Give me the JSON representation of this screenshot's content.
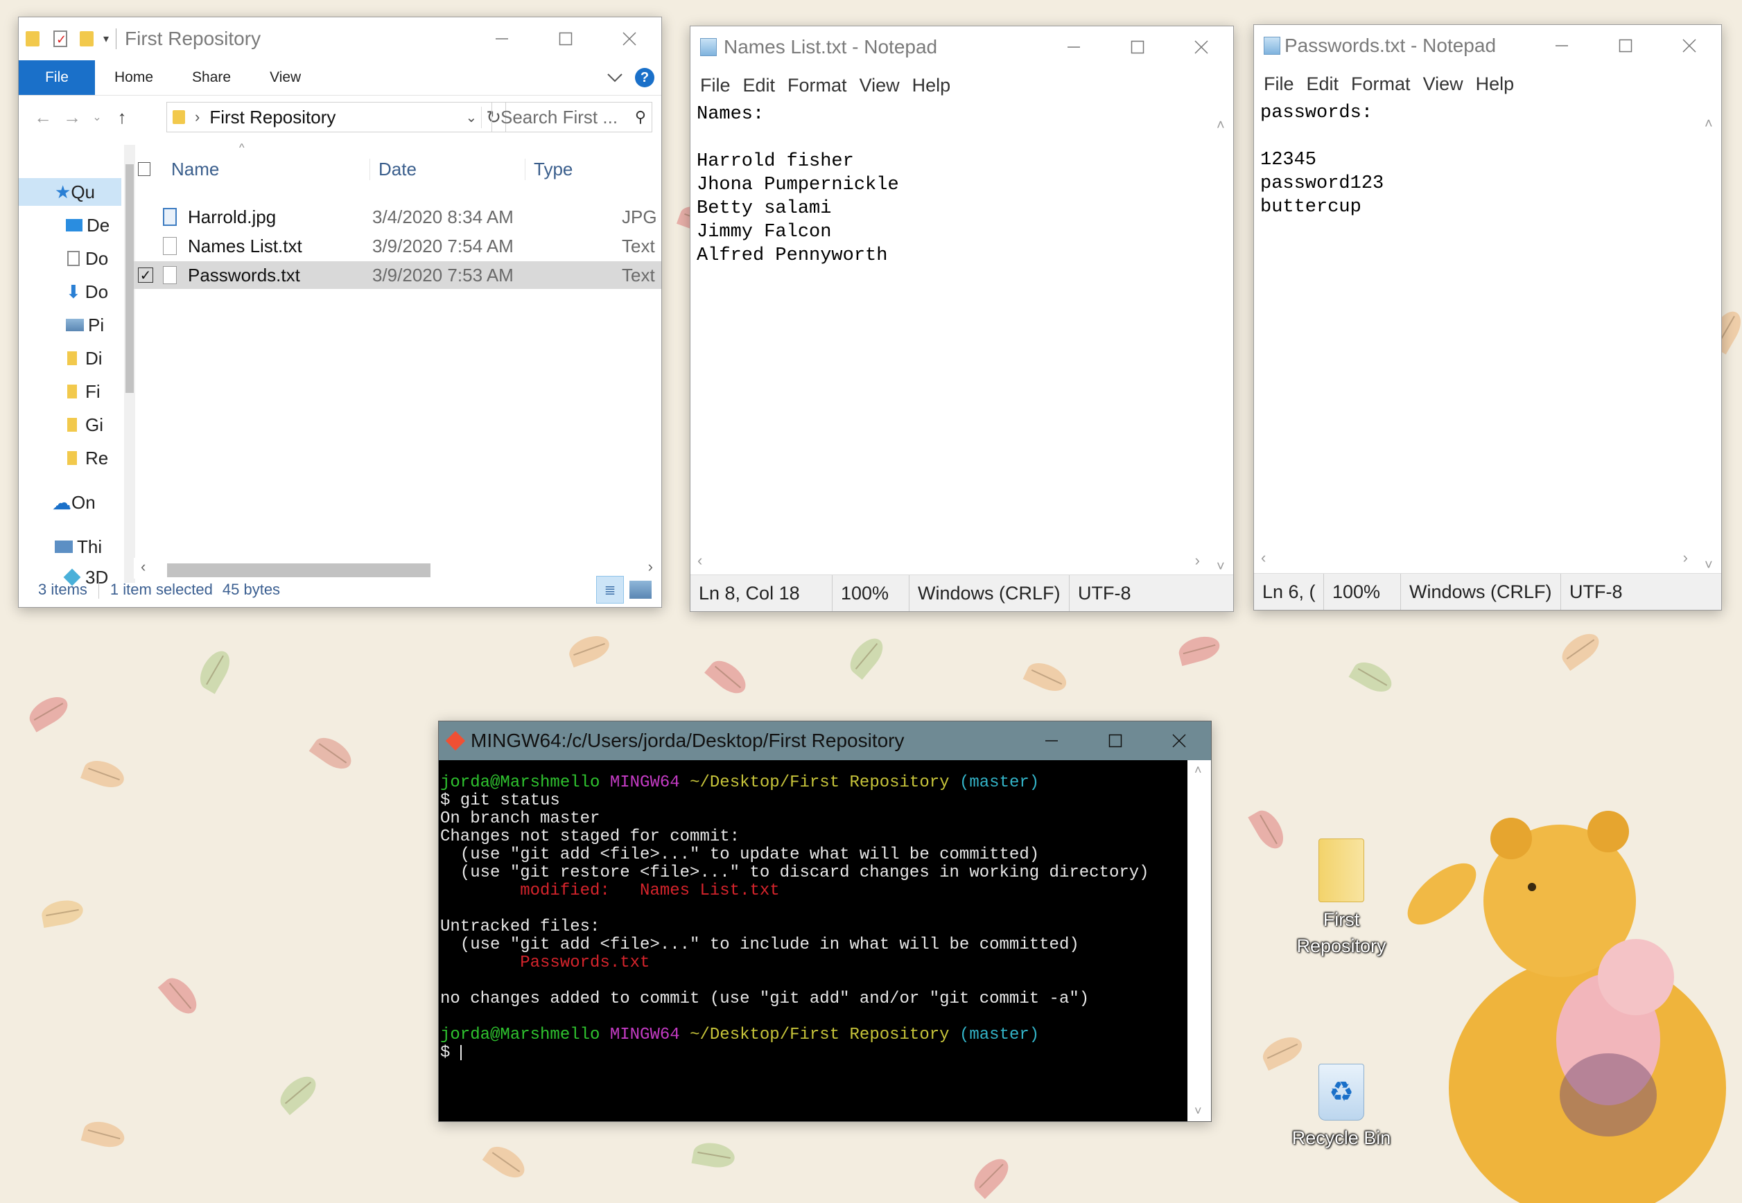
{
  "explorer": {
    "title": "First Repository",
    "ribbon_tabs": [
      "File",
      "Home",
      "Share",
      "View"
    ],
    "address": "First Repository",
    "search_placeholder": "Search First ...",
    "columns": [
      "Name",
      "Date",
      "Type"
    ],
    "nav_items": [
      "Qu",
      "De",
      "Do",
      "Do",
      "Pi",
      "Di",
      "Fi",
      "Gi",
      "Re",
      "On",
      "Thi",
      "3D"
    ],
    "files": [
      {
        "name": "Harrold.jpg",
        "date": "3/4/2020 8:34 AM",
        "type": "JPG",
        "icon": "image-file-icon"
      },
      {
        "name": "Names List.txt",
        "date": "3/9/2020 7:54 AM",
        "type": "Text",
        "icon": "text-file-icon"
      },
      {
        "name": "Passwords.txt",
        "date": "3/9/2020 7:53 AM",
        "type": "Text",
        "icon": "text-file-icon"
      }
    ],
    "status_items": "3 items",
    "status_selected": "1 item selected",
    "status_size": "45 bytes"
  },
  "notepad_names": {
    "title": "Names List.txt - Notepad",
    "menu": [
      "File",
      "Edit",
      "Format",
      "View",
      "Help"
    ],
    "content": "Names:\n\nHarrold fisher\nJhona Pumpernickle\nBetty salami\nJimmy Falcon\nAlfred Pennyworth",
    "status": [
      "Ln 8, Col 18",
      "100%",
      "Windows (CRLF)",
      "UTF-8"
    ]
  },
  "notepad_passwords": {
    "title": "Passwords.txt - Notepad",
    "menu": [
      "File",
      "Edit",
      "Format",
      "View",
      "Help"
    ],
    "content": "passwords:\n\n12345\npassword123\nbuttercup",
    "status": [
      "Ln 6, (",
      "100%",
      "Windows (CRLF)",
      "UTF-8"
    ]
  },
  "terminal": {
    "title": "MINGW64:/c/Users/jorda/Desktop/First Repository",
    "prompt_user": "jorda@Marshmello",
    "prompt_env": "MINGW64",
    "prompt_path": "~/Desktop/First Repository",
    "prompt_branch": "(master)",
    "command": "$ git status",
    "lines": [
      "On branch master",
      "Changes not staged for commit:",
      "  (use \"git add <file>...\" to update what will be committed)",
      "  (use \"git restore <file>...\" to discard changes in working directory)"
    ],
    "modified_line": "        modified:   Names List.txt",
    "untracked_header": "Untracked files:",
    "untracked_hint": "  (use \"git add <file>...\" to include in what will be committed)",
    "untracked_file": "        Passwords.txt",
    "footer": "no changes added to commit (use \"git add\" and/or \"git commit -a\")",
    "final_prompt": "$ "
  },
  "desktop": {
    "icons": [
      {
        "label": "First Repository",
        "icon": "folder-icon"
      },
      {
        "label": "Recycle Bin",
        "icon": "recycle-bin-icon"
      }
    ]
  },
  "colors": {
    "explorer_accent": "#1a70c9",
    "selection": "#cce4f7",
    "terminal_title": "#6f8a94",
    "wallpaper": "#f3ede0"
  }
}
